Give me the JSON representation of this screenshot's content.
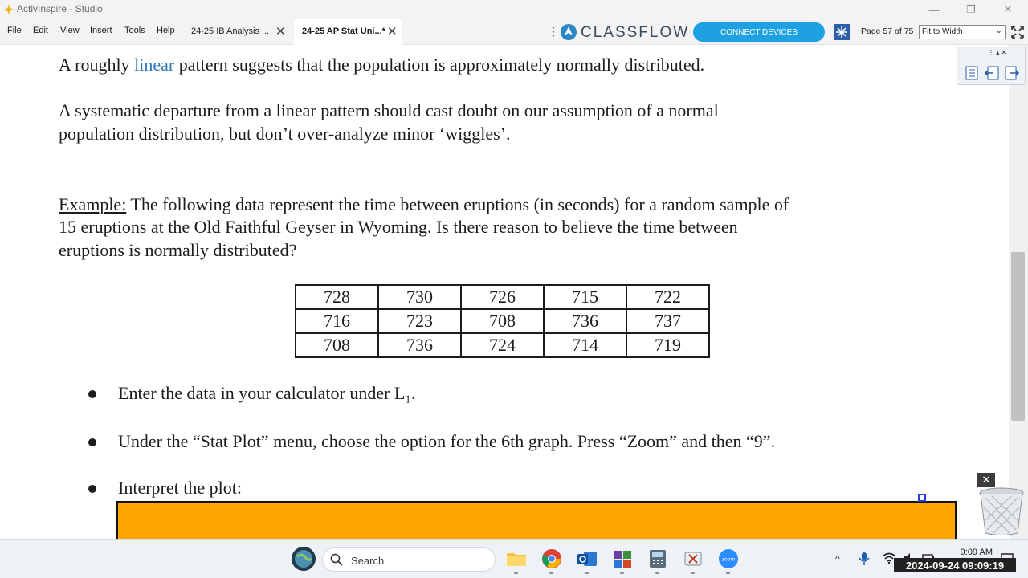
{
  "window": {
    "title": "ActivInspire - Studio",
    "minimize": "—",
    "restore": "❐",
    "close": "✕"
  },
  "menu": {
    "items": [
      "File",
      "Edit",
      "View",
      "Insert",
      "Tools",
      "Help"
    ]
  },
  "tabs": [
    {
      "label": "24-25 IB Analysis ...",
      "close": "✕"
    },
    {
      "label": "24-25 AP Stat Uni...*",
      "close": "✕"
    }
  ],
  "toolbar": {
    "kebab": "⋮",
    "classflow": "CLASSFLOW",
    "connect_label": "CONNECT DEVICES",
    "page_label": "Page 57 of 75",
    "zoom_value": "Fit to Width",
    "zoom_caret": "⌄"
  },
  "doc": {
    "line1_pre": "A roughly ",
    "line1_link": "linear",
    "line1_post": " pattern suggests that the population is approximately normally distributed.",
    "para2_line1": "A systematic departure from a linear pattern should cast doubt on our assumption of a normal",
    "para2_line2": "population distribution, but don’t over-analyze minor ‘wiggles’.",
    "example_label": "Example:",
    "example_line1": " The following data represent the time between eruptions (in seconds) for a random sample of",
    "example_line2": "15 eruptions at the Old Faithful Geyser in Wyoming.  Is there reason to believe the time between",
    "example_line3": "eruptions is normally distributed?",
    "table": [
      [
        "728",
        "730",
        "726",
        "715",
        "722"
      ],
      [
        "716",
        "723",
        "708",
        "736",
        "737"
      ],
      [
        "708",
        "736",
        "724",
        "714",
        "719"
      ]
    ],
    "bullet1": "Enter the data in your calculator under L₁.",
    "bullet2": "Under the “Stat Plot” menu, choose the option for the 6th graph.  Press “Zoom” and then “9”.",
    "bullet3": "Interpret the plot:"
  },
  "toolbox": {
    "top_controls": "⋮ ▴ ✕",
    "trash_close": "✕"
  },
  "taskbar": {
    "search_placeholder": "Search",
    "tray_chevron": "^",
    "clock_time": "9:09 AM",
    "timestamp": "2024-09-24 09:09:19"
  },
  "colors": {
    "connect_button": "#1da1e2",
    "answer_box": "#ffa600",
    "link": "#2d79b8"
  }
}
